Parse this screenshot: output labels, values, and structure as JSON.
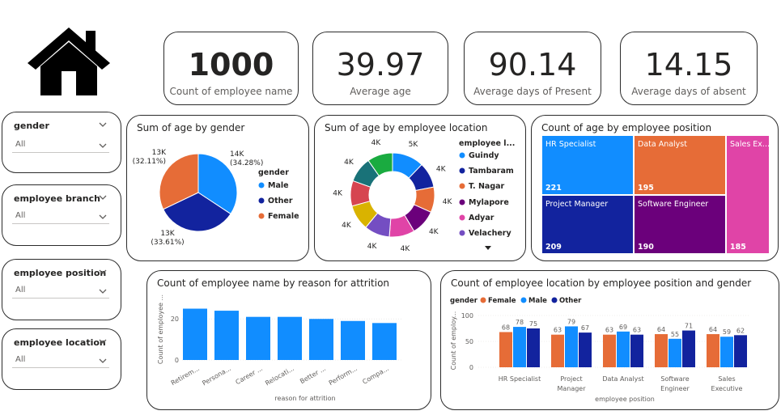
{
  "kpis": [
    {
      "value": "1000",
      "label": "Count of employee name"
    },
    {
      "value": "39.97",
      "label": "Average age"
    },
    {
      "value": "90.14",
      "label": "Average days of Present"
    },
    {
      "value": "14.15",
      "label": "Average days of absent"
    }
  ],
  "slicers": [
    {
      "title": "gender",
      "value": "All"
    },
    {
      "title": "employee branch",
      "value": "All"
    },
    {
      "title": "employee position",
      "value": "All"
    },
    {
      "title": "employee location",
      "value": "All"
    }
  ],
  "colors": {
    "blue": "#118dff",
    "navy": "#12239e",
    "orange": "#e66c37",
    "purple": "#6b007b",
    "pink": "#e044a7",
    "violet": "#744ec2",
    "yellow": "#d9b300",
    "red": "#d64550",
    "teal": "#197278",
    "green": "#1aab40"
  },
  "icons": {
    "home": "home-icon",
    "dropdown": "chevron-down-icon"
  },
  "chart_data": [
    {
      "type": "pie",
      "title": "Sum of age by gender",
      "legend_title": "gender",
      "legend_placement": "right",
      "categories": [
        "Male",
        "Other",
        "Female"
      ],
      "values": [
        14,
        13,
        13
      ],
      "labels": [
        [
          "14K",
          "(34.28%)"
        ],
        [
          "13K",
          "(33.61%)"
        ],
        [
          "13K",
          "(32.11%)"
        ]
      ],
      "percents": [
        34.28,
        33.61,
        32.11
      ]
    },
    {
      "type": "pie",
      "title": "Sum of age by employee location",
      "legend_title": "employee l...",
      "legend_placement": "right",
      "categories": [
        "Guindy",
        "Tambaram",
        "T. Nagar",
        "Mylapore",
        "Adyar",
        "Velachery"
      ],
      "values": [
        5,
        4,
        4,
        4,
        4,
        4,
        4,
        4,
        4,
        4
      ],
      "data_labels": [
        "5K",
        "4K",
        "4K",
        "4K",
        "4K",
        "4K",
        "4K",
        "4K",
        "4K",
        "4K"
      ]
    },
    {
      "type": "treemap",
      "title": "Count of age by employee position",
      "categories": [
        "HR Specialist",
        "Data Analyst",
        "Sales Ex...",
        "Project Manager",
        "Software Engineer"
      ],
      "values": [
        221,
        195,
        185,
        209,
        190
      ]
    },
    {
      "type": "bar",
      "title": "Count of employee name by reason for attrition",
      "xlabel": "reason for attrition",
      "ylabel": "Count of employee ...",
      "categories": [
        "Retirem...",
        "Persona...",
        "Career ...",
        "Relocati...",
        "Better ...",
        "Perform...",
        "Compa..."
      ],
      "values": [
        25,
        24,
        21,
        21,
        20,
        19,
        18
      ],
      "yticks": [
        "0",
        "20"
      ],
      "ylim": [
        0,
        26
      ]
    },
    {
      "type": "bar",
      "title": "Count of employee location by employee position and gender",
      "legend_title": "gender",
      "legend_placement": "top-left",
      "xlabel": "employee position",
      "ylabel": "Count of employ...",
      "categories": [
        [
          "HR Specialist"
        ],
        [
          "Project",
          "Manager"
        ],
        [
          "Data Analyst"
        ],
        [
          "Software",
          "Engineer"
        ],
        [
          "Sales",
          "Executive"
        ]
      ],
      "series": [
        {
          "name": "Female",
          "values": [
            68,
            63,
            63,
            64,
            64
          ]
        },
        {
          "name": "Male",
          "values": [
            78,
            79,
            69,
            55,
            59
          ]
        },
        {
          "name": "Other",
          "values": [
            75,
            67,
            63,
            71,
            62
          ]
        }
      ],
      "yticks": [
        "0",
        "50",
        "100"
      ],
      "ylim": [
        0,
        100
      ]
    }
  ]
}
